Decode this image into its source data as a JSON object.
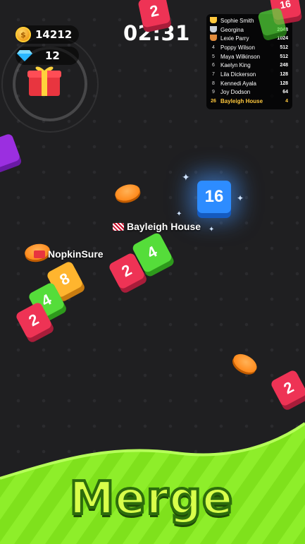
{
  "hud": {
    "coins": "14212",
    "gems": "12",
    "timer": "02:31"
  },
  "leaderboard": [
    {
      "rank": "",
      "name": "Sophie Smith",
      "score": "2048",
      "trophy": "gold"
    },
    {
      "rank": "",
      "name": "Georgina",
      "score": "2048",
      "trophy": "silver"
    },
    {
      "rank": "",
      "name": "Lexie Parry",
      "score": "1024",
      "trophy": "bronze"
    },
    {
      "rank": "4",
      "name": "Poppy Wilson",
      "score": "512"
    },
    {
      "rank": "5",
      "name": "Maya Wilkinson",
      "score": "512"
    },
    {
      "rank": "6",
      "name": "Kaelyn King",
      "score": "248"
    },
    {
      "rank": "7",
      "name": "Lila Dickerson",
      "score": "128"
    },
    {
      "rank": "8",
      "name": "Kennedi Ayala",
      "score": "128"
    },
    {
      "rank": "9",
      "name": "Joy Dodson",
      "score": "64"
    },
    {
      "rank": "26",
      "name": "Bayleigh House",
      "score": "4",
      "me": true
    }
  ],
  "players": {
    "me": "Bayleigh House",
    "opponent": "NopkinSure"
  },
  "cubes": {
    "top_red": "2",
    "blue_glow": "16",
    "me_green": "4",
    "me_red": "2",
    "opp_yellow": "8",
    "opp_green": "4",
    "opp_red": "2",
    "right_red": "2",
    "top_right_red": "16"
  },
  "banner": {
    "text": "Merge"
  },
  "colors": {
    "red": "#ee3355",
    "green": "#55dd3a",
    "yellow": "#ffb52e",
    "blue": "#2d8cff",
    "highlight": "#ffc83d"
  },
  "icons": [
    "coin-icon",
    "gem-icon",
    "gift-box-icon",
    "trophy-icon",
    "flag-icon",
    "sparkle-icon"
  ]
}
